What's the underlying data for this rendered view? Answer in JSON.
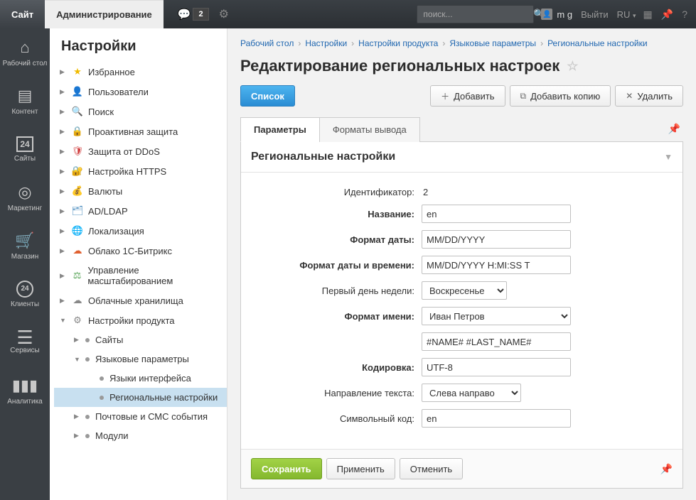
{
  "topbar": {
    "site": "Сайт",
    "admin": "Администрирование",
    "notif_count": "2",
    "search_placeholder": "поиск...",
    "user": "m g",
    "logout": "Выйти",
    "lang": "RU"
  },
  "iconbar": [
    {
      "icon": "⌂",
      "label": "Рабочий стол"
    },
    {
      "icon": "▤",
      "label": "Контент"
    },
    {
      "icon": "24",
      "label": "Сайты",
      "boxed": true
    },
    {
      "icon": "◎",
      "label": "Маркетинг"
    },
    {
      "icon": "🛒",
      "label": "Магазин"
    },
    {
      "icon": "24",
      "label": "Клиенты",
      "circled": true
    },
    {
      "icon": "≡",
      "label": "Сервисы"
    },
    {
      "icon": "📊",
      "label": "Аналитика"
    }
  ],
  "tree": {
    "title": "Настройки",
    "items": [
      {
        "icon": "★",
        "label": "Избранное",
        "color": "#f0bb00"
      },
      {
        "icon": "👤",
        "label": "Пользователи",
        "color": "#6bb0d8"
      },
      {
        "icon": "🔍",
        "label": "Поиск",
        "color": "#888"
      },
      {
        "icon": "🔒",
        "label": "Проактивная защита",
        "color": "#e0a030"
      },
      {
        "icon": "🛡",
        "label": "Защита от DDoS",
        "color": "#d04040"
      },
      {
        "icon": "🔐",
        "label": "Настройка HTTPS",
        "color": "#3080d0"
      },
      {
        "icon": "💰",
        "label": "Валюты",
        "color": "#888"
      },
      {
        "icon": "🗂",
        "label": "AD/LDAP",
        "color": "#5090c0"
      },
      {
        "icon": "🌐",
        "label": "Локализация",
        "color": "#3080d0"
      },
      {
        "icon": "☁",
        "label": "Облако 1С-Битрикс",
        "color": "#e06030"
      },
      {
        "icon": "⚖",
        "label": "Управление масштабированием",
        "color": "#50a050"
      },
      {
        "icon": "☁",
        "label": "Облачные хранилища",
        "color": "#888"
      },
      {
        "icon": "⚙",
        "label": "Настройки продукта",
        "color": "#888",
        "expanded": true,
        "children": [
          {
            "label": "Сайты"
          },
          {
            "label": "Языковые параметры",
            "expanded": true,
            "children": [
              {
                "label": "Языки интерфейса"
              },
              {
                "label": "Региональные настройки",
                "selected": true
              }
            ]
          },
          {
            "label": "Почтовые и СМС события"
          },
          {
            "label": "Модули"
          }
        ]
      }
    ]
  },
  "breadcrumbs": [
    "Рабочий стол",
    "Настройки",
    "Настройки продукта",
    "Языковые параметры",
    "Региональные настройки"
  ],
  "page_title": "Редактирование региональных настроек",
  "actions": {
    "list": "Список",
    "add": "Добавить",
    "copy": "Добавить копию",
    "delete": "Удалить"
  },
  "tabs": {
    "params": "Параметры",
    "formats": "Форматы вывода"
  },
  "panel": {
    "title": "Региональные настройки",
    "rows": {
      "id_label": "Идентификатор:",
      "id_value": "2",
      "name_label": "Название:",
      "name_value": "en",
      "date_label": "Формат даты:",
      "date_value": "MM/DD/YYYY",
      "datetime_label": "Формат даты и времени:",
      "datetime_value": "MM/DD/YYYY H:MI:SS T",
      "firstday_label": "Первый день недели:",
      "firstday_value": "Воскресенье",
      "nameformat_label": "Формат имени:",
      "nameformat_select": "Иван Петров",
      "nameformat_value": "#NAME# #LAST_NAME#",
      "encoding_label": "Кодировка:",
      "encoding_value": "UTF-8",
      "direction_label": "Направление текста:",
      "direction_value": "Слева направо",
      "code_label": "Символьный код:",
      "code_value": "en"
    }
  },
  "footer": {
    "save": "Сохранить",
    "apply": "Применить",
    "cancel": "Отменить"
  }
}
